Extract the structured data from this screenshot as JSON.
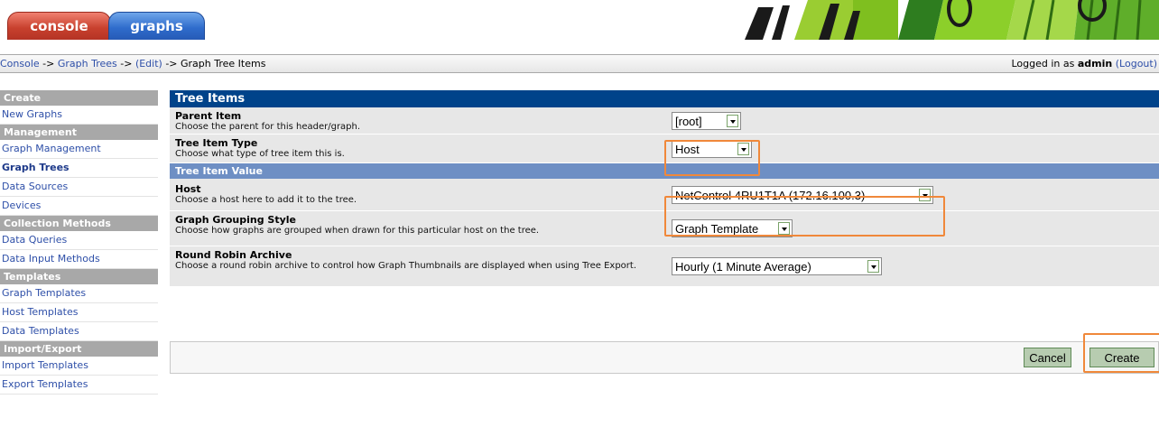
{
  "tabs": [
    {
      "label": "console"
    },
    {
      "label": "graphs"
    }
  ],
  "breadcrumb": {
    "console": "Console",
    "sep1": " -> ",
    "graph_trees": "Graph Trees",
    "sep2": " -> ",
    "edit": "(Edit)",
    "sep3": " -> ",
    "current": "Graph Tree Items"
  },
  "login": {
    "prefix": "Logged in as ",
    "user": "admin",
    "logout": "(Logout)"
  },
  "sidebar": {
    "create_header": "Create",
    "new_graphs": "New Graphs",
    "management_header": "Management",
    "graph_management": "Graph Management",
    "graph_trees": "Graph Trees",
    "data_sources": "Data Sources",
    "devices": "Devices",
    "collection_header": "Collection Methods",
    "data_queries": "Data Queries",
    "data_input_methods": "Data Input Methods",
    "templates_header": "Templates",
    "graph_templates": "Graph Templates",
    "host_templates": "Host Templates",
    "data_templates": "Data Templates",
    "import_export_header": "Import/Export",
    "import_templates": "Import Templates",
    "export_templates": "Export Templates"
  },
  "form": {
    "title": "Tree Items",
    "parent_item": {
      "label": "Parent Item",
      "help": "Choose the parent for this header/graph.",
      "value": "[root]"
    },
    "tree_item_type": {
      "label": "Tree Item Type",
      "help": "Choose what type of tree item this is.",
      "value": "Host"
    },
    "value_header": "Tree Item Value",
    "host": {
      "label": "Host",
      "help": "Choose a host here to add it to the tree.",
      "value": "NetControl 4RU1T1A (172.16.100.3)"
    },
    "grouping": {
      "label": "Graph Grouping Style",
      "help": "Choose how graphs are grouped when drawn for this particular host on the tree.",
      "value": "Graph Template"
    },
    "rra": {
      "label": "Round Robin Archive",
      "help": "Choose a round robin archive to control how Graph Thumbnails are displayed when using Tree Export.",
      "value": "Hourly (1 Minute Average)"
    },
    "cancel_label": "Cancel",
    "create_label": "Create"
  },
  "colors": {
    "header": "#00438a",
    "subheader": "#6e8fc4",
    "highlight": "#f0883a",
    "tab_console": "#c8412e",
    "tab_graphs": "#2f6ccc"
  }
}
